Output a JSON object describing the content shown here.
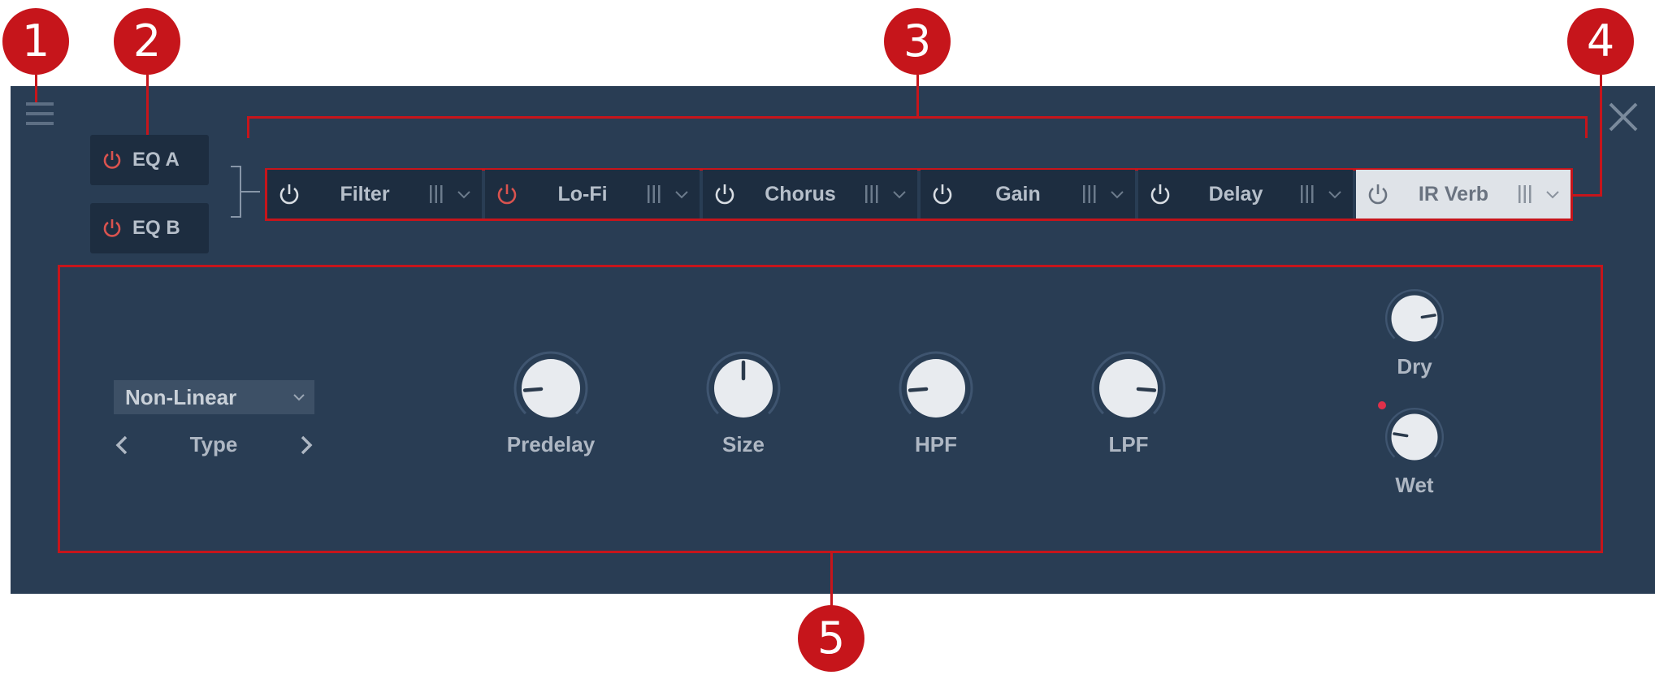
{
  "callouts": [
    "1",
    "2",
    "3",
    "4",
    "5"
  ],
  "eq_buttons": [
    {
      "label": "EQ A",
      "power_color": "#d9534f"
    },
    {
      "label": "EQ B",
      "power_color": "#d9534f"
    }
  ],
  "effect_slots": [
    {
      "name": "Filter",
      "power_color": "#d8dde3",
      "selected": false
    },
    {
      "name": "Lo-Fi",
      "power_color": "#d9534f",
      "selected": false
    },
    {
      "name": "Chorus",
      "power_color": "#d8dde3",
      "selected": false
    },
    {
      "name": "Gain",
      "power_color": "#d8dde3",
      "selected": false
    },
    {
      "name": "Delay",
      "power_color": "#d8dde3",
      "selected": false
    },
    {
      "name": "IR Verb",
      "power_color": "#6a7380",
      "selected": true
    }
  ],
  "type_selector": {
    "value": "Non-Linear",
    "label": "Type"
  },
  "knobs": {
    "predelay": {
      "label": "Predelay",
      "value": 0.15
    },
    "size": {
      "label": "Size",
      "value": 0.5
    },
    "hpf": {
      "label": "HPF",
      "value": 0.15
    },
    "lpf": {
      "label": "LPF",
      "value": 0.85
    },
    "dry": {
      "label": "Dry",
      "value": 0.8
    },
    "wet": {
      "label": "Wet",
      "value": 0.2
    }
  },
  "colors": {
    "callout": "#c6151b",
    "panel": "#293d54",
    "slot": "#1d2d40",
    "selected_slot": "#dfe3e8",
    "power_active": "#d9534f"
  }
}
